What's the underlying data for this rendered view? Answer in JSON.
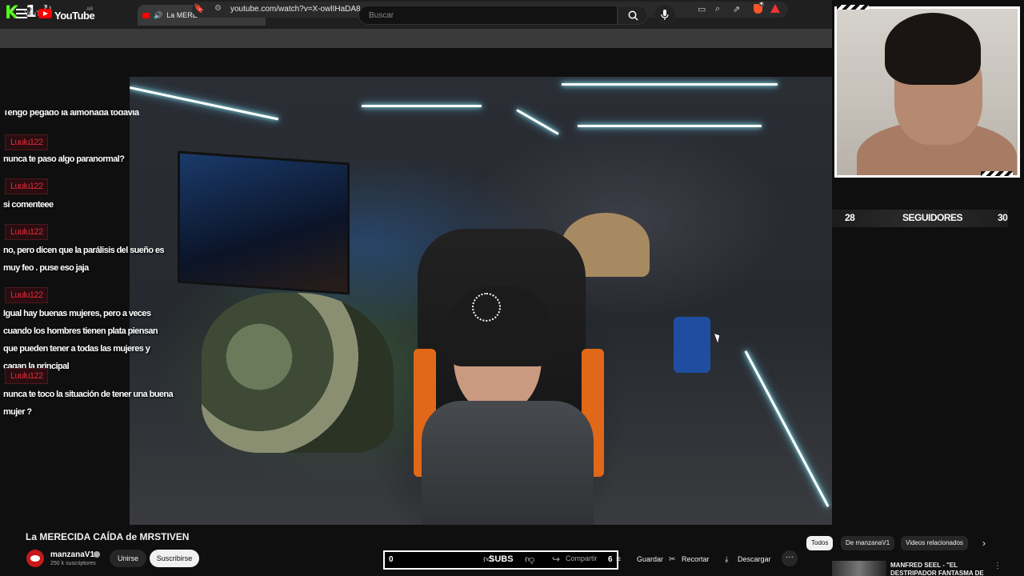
{
  "browser": {
    "overlay_number": "1",
    "inactive_tab_title": "YouTube",
    "active_tab_title": "La MERECIDA CAÍDA de MRSTIVEN",
    "url": "youtube.com/watch?v=X-owlIHaDA8"
  },
  "youtube": {
    "logo_text": "YouTube",
    "country_code": "AR",
    "search_placeholder": "Buscar"
  },
  "chat": {
    "cut_off_message": "Tengo pegado la almohada todavía",
    "messages": [
      {
        "user": "Luulu122",
        "text": "nunca te paso algo paranormal?"
      },
      {
        "user": "Luulu122",
        "text": "si comenteee"
      },
      {
        "user": "Luulu122",
        "text": "no, pero dicen que la parálisis del sueño es muy feo . puse eso jaja"
      },
      {
        "user": "Luulu122",
        "text": "Igual hay buenas mujeres, pero a veces cuando los hombres tienen plata piensan que pueden tener a todas las mujeres y cagan la principal"
      },
      {
        "user": "Luulu122",
        "text": "nunca te toco la situación de tener una buena mujer ?"
      }
    ]
  },
  "followers": {
    "current": "28",
    "label": "SEGUIDORES",
    "goal": "30"
  },
  "video": {
    "title": "La MERECIDA CAÍDA de MRSTIVEN",
    "channel": "manzanaV1",
    "subscribers": "250 k suscriptores",
    "join_label": "Unirse",
    "subscribe_label": "Suscribirse"
  },
  "subs_overlay": {
    "value": "0",
    "label": "SUBS",
    "goal": "6",
    "share_label": "Compartir"
  },
  "actions": {
    "save": "Guardar",
    "clip": "Recortar",
    "download": "Descargar",
    "more": "···"
  },
  "chips": [
    "Todos",
    "De manzanaV1",
    "Videos relacionados"
  ],
  "related": {
    "title": "MANFRED SEEL - \"EL DESTRIPADOR FANTASMA DE"
  },
  "colors": {
    "kick_green": "#53fc18",
    "youtube_red": "#ff0000",
    "chat_user": "#e02a3a"
  }
}
